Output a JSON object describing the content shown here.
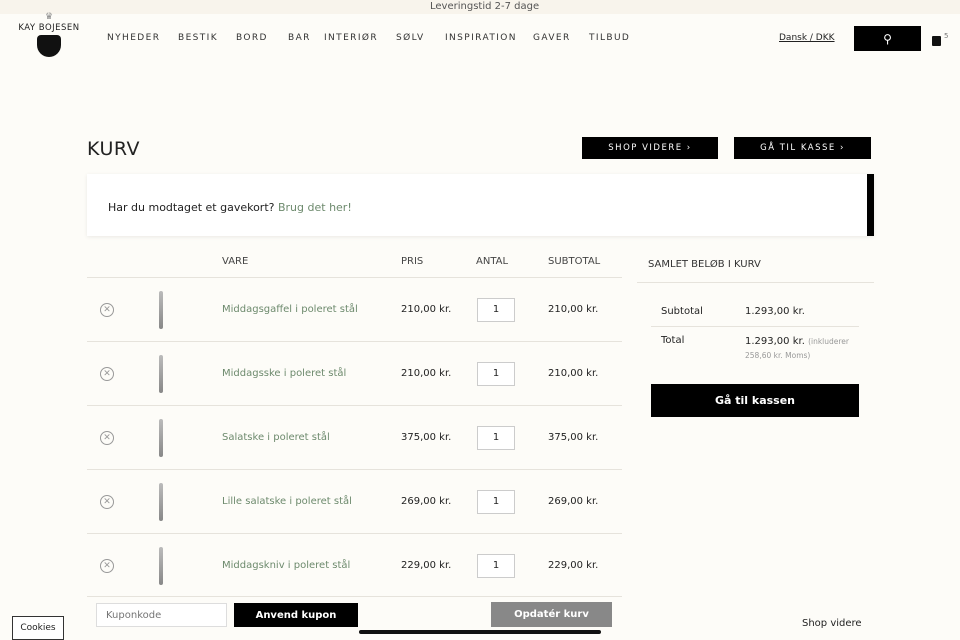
{
  "topbar": {
    "delivery": "Leveringstid 2-7 dage"
  },
  "logo": {
    "text": "KAY BOJESEN",
    "subtitle": "By appointment to the Royal Danish Court"
  },
  "nav": [
    "NYHEDER",
    "BESTIK",
    "BORD",
    "BAR",
    "INTERIØR",
    "SØLV",
    "INSPIRATION",
    "GAVER",
    "TILBUD"
  ],
  "header": {
    "language": "Dansk / DKK",
    "cart_count": "5",
    "search_icon": "search-icon",
    "bag_icon": "bag-icon"
  },
  "page": {
    "title": "KURV",
    "shop_more": "SHOP VIDERE ›",
    "checkout": "GÅ TIL KASSE ›"
  },
  "gift": {
    "text": "Har du modtaget et gavekort?",
    "link": "Brug det her!"
  },
  "table": {
    "headers": {
      "item": "VARE",
      "price": "PRIS",
      "qty": "ANTAL",
      "subtotal": "SUBTOTAL"
    },
    "rows": [
      {
        "name": "Middagsgaffel i poleret stål",
        "price": "210,00 kr.",
        "qty": "1",
        "subtotal": "210,00 kr."
      },
      {
        "name": "Middagsske i poleret stål",
        "price": "210,00 kr.",
        "qty": "1",
        "subtotal": "210,00 kr."
      },
      {
        "name": "Salatske i poleret stål",
        "price": "375,00 kr.",
        "qty": "1",
        "subtotal": "375,00 kr."
      },
      {
        "name": "Lille salatske i poleret stål",
        "price": "269,00 kr.",
        "qty": "1",
        "subtotal": "269,00 kr."
      },
      {
        "name": "Middagskniv i poleret stål",
        "price": "229,00 kr.",
        "qty": "1",
        "subtotal": "229,00 kr."
      }
    ]
  },
  "actions": {
    "coupon_placeholder": "Kuponkode",
    "apply": "Anvend kupon",
    "update": "Opdatér kurv"
  },
  "summary": {
    "title": "SAMLET BELØB I KURV",
    "subtotal_label": "Subtotal",
    "subtotal": "1.293,00 kr.",
    "total_label": "Total",
    "total": "1.293,00 kr.",
    "vat_note": "(inkluderer 258,60 kr. Moms)",
    "checkout": "Gå til kassen"
  },
  "footer": {
    "shop_more": "Shop videre",
    "cookies": "Cookies"
  }
}
